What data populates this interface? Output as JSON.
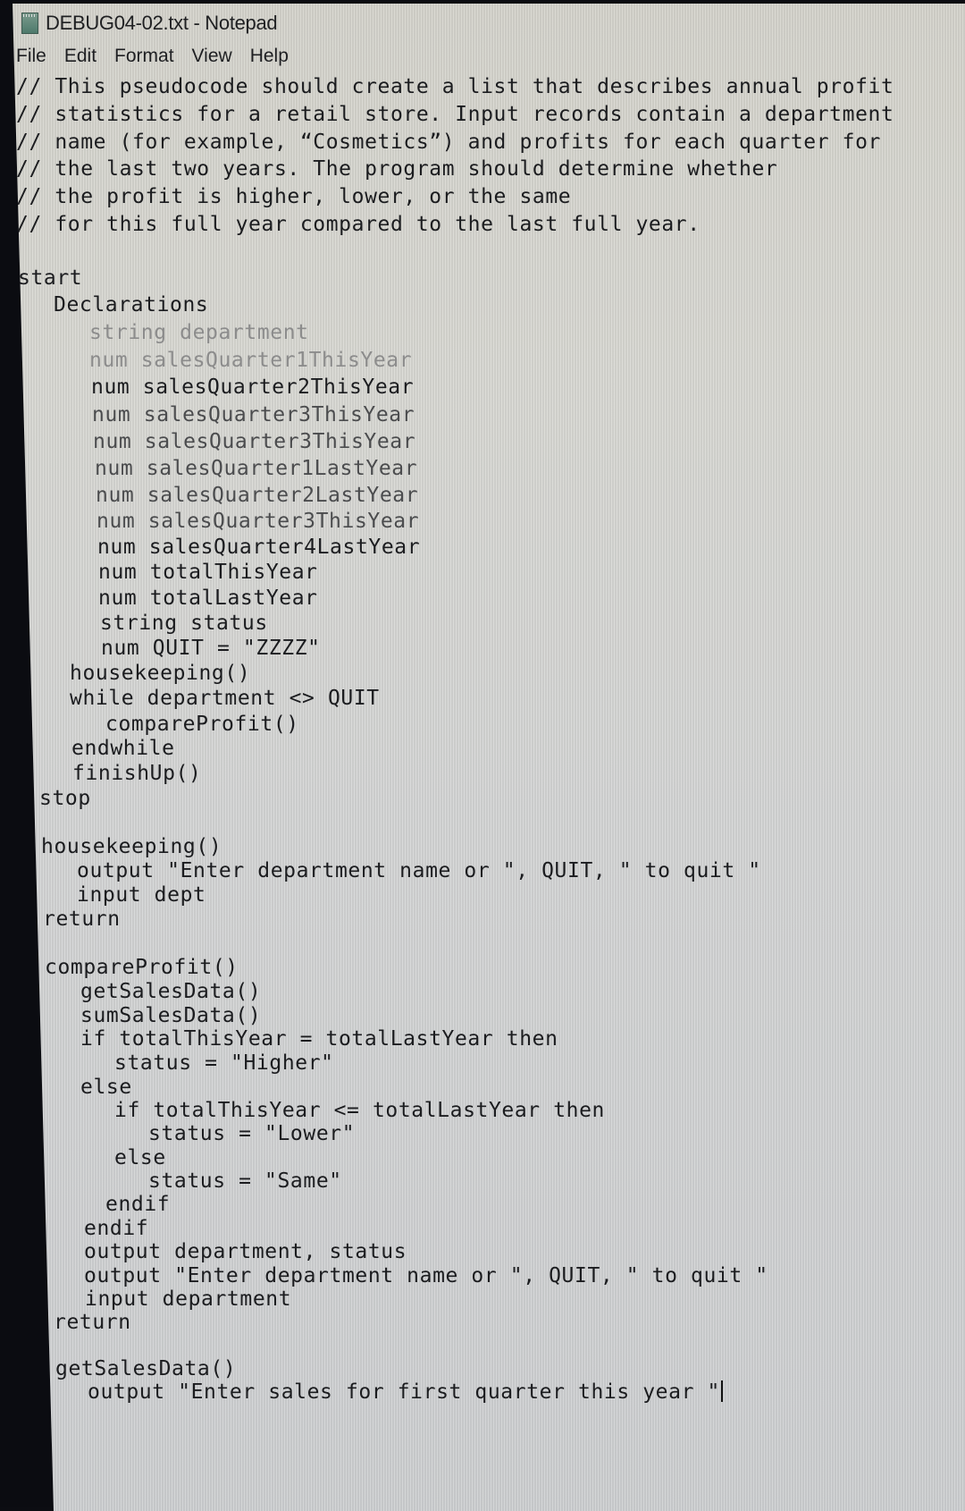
{
  "window": {
    "title": "DEBUG04-02.txt - Notepad",
    "app_icon": "notepad-icon"
  },
  "menu": {
    "items": [
      "File",
      "Edit",
      "Format",
      "View",
      "Help"
    ]
  },
  "editor": {
    "cursor_after_line": 46,
    "lines": [
      "// This pseudocode should create a list that describes annual profit",
      "// statistics for a retail store. Input records contain a department",
      "// name (for example, “Cosmetics”) and profits for each quarter for",
      "// the last two years. The program should determine whether",
      "// the profit is higher, lower, or the same",
      "// for this full year compared to the last full year.",
      "",
      "start",
      "Declarations",
      "string department",
      "num salesQuarter1ThisYear",
      "num salesQuarter2ThisYear",
      "num salesQuarter3ThisYear",
      "num salesQuarter3ThisYear",
      "num salesQuarter1LastYear",
      "num salesQuarter2LastYear",
      "num salesQuarter3ThisYear",
      "num salesQuarter4LastYear",
      "num totalThisYear",
      "num totalLastYear",
      "string status",
      "num QUIT = \"ZZZZ\"",
      "housekeeping()",
      "while department <> QUIT",
      "compareProfit()",
      "endwhile",
      "finishUp()",
      "stop",
      "",
      "housekeeping()",
      "output \"Enter department name or \", QUIT, \" to quit \"",
      "input dept",
      "return",
      "",
      "compareProfit()",
      "getSalesData()",
      "sumSalesData()",
      "if totalThisYear = totalLastYear then",
      "status = \"Higher\"",
      "else",
      "if totalThisYear <= totalLastYear then",
      "status = \"Lower\"",
      "else",
      "status = \"Same\"",
      "endif",
      "endif",
      "output department, status",
      "output \"Enter department name or \", QUIT, \" to quit \"",
      "input department",
      "return",
      "",
      "getSalesData()",
      "output \"Enter sales for first quarter this year \""
    ]
  }
}
